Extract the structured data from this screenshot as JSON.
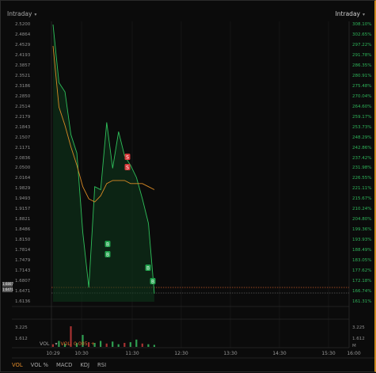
{
  "header": {
    "left_label": "Intraday",
    "right_label": "Intraday"
  },
  "price_axis_left": [
    "2.5200",
    "2.4864",
    "2.4529",
    "2.4193",
    "2.3857",
    "2.3521",
    "2.3186",
    "2.2850",
    "2.2514",
    "2.2179",
    "2.1843",
    "2.1507",
    "2.1171",
    "2.0836",
    "2.0500",
    "2.0164",
    "1.9829",
    "1.9493",
    "1.9157",
    "1.8821",
    "1.8486",
    "1.8150",
    "1.7814",
    "1.7479",
    "1.7143",
    "1.6807",
    "1.6471",
    "1.6136"
  ],
  "price_axis_right": [
    "308.10%",
    "302.65%",
    "297.22%",
    "291.78%",
    "286.35%",
    "280.91%",
    "275.48%",
    "270.04%",
    "264.60%",
    "259.17%",
    "253.73%",
    "248.29%",
    "242.86%",
    "237.42%",
    "231.98%",
    "226.55%",
    "221.11%",
    "215.67%",
    "210.24%",
    "204.80%",
    "199.36%",
    "193.93%",
    "188.49%",
    "183.05%",
    "177.62%",
    "172.18%",
    "166.74%",
    "161.31%"
  ],
  "price_tags_left": [
    "1.6807",
    "1.6471"
  ],
  "price_tags_right": [
    "172.18%",
    "166.74%"
  ],
  "time_axis": [
    "10:29",
    "10:30",
    "11:30",
    "12:30",
    "13:30",
    "14:30",
    "15:30",
    "16:00"
  ],
  "volume": {
    "legend_name": "VOL",
    "legend_value": "VOL: 0.005",
    "ticks_left": [
      "3.225",
      "1.612"
    ],
    "ticks_right": [
      "3.225",
      "1.612",
      "M"
    ]
  },
  "tabs": [
    "VOL",
    "VOL %",
    "MACD",
    "KDJ",
    "RSI"
  ],
  "active_tab": "VOL",
  "markers": [
    "S",
    "S",
    "B",
    "B",
    "B",
    "B"
  ],
  "colors": {
    "price_line": "#2fbf5a",
    "avg_line": "#d98a25",
    "buy": "#1fa04a",
    "sell": "#d63a3a",
    "accent": "#e08a2a"
  },
  "chart_data": {
    "type": "line",
    "x": [
      "10:29",
      "10:35",
      "10:40",
      "10:45",
      "10:50",
      "10:55",
      "11:00",
      "11:05",
      "11:10",
      "11:15",
      "11:20",
      "11:25",
      "11:30",
      "11:35",
      "11:40",
      "11:45",
      "11:50",
      "11:55"
    ],
    "series": [
      {
        "values": [
          2.52,
          2.33,
          2.3,
          2.16,
          2.1,
          1.84,
          1.66,
          1.99,
          1.98,
          2.2,
          2.05,
          2.17,
          2.09,
          2.06,
          2.02,
          1.95,
          1.87,
          1.64
        ]
      },
      {
        "values": [
          2.45,
          2.25,
          2.19,
          2.12,
          2.06,
          1.99,
          1.95,
          1.94,
          1.96,
          2.0,
          2.01,
          2.01,
          2.01,
          2.0,
          2.0,
          2.0,
          1.99,
          1.98
        ]
      }
    ],
    "volume": [
      0.4,
      0.9,
      0.5,
      3.1,
      0.6,
      1.8,
      0.7,
      0.6,
      0.9,
      0.5,
      0.8,
      0.4,
      0.6,
      0.7,
      1.1,
      0.5,
      0.4,
      0.3
    ],
    "ylim": [
      1.6136,
      2.52
    ],
    "xlabel": "",
    "ylabel": ""
  }
}
